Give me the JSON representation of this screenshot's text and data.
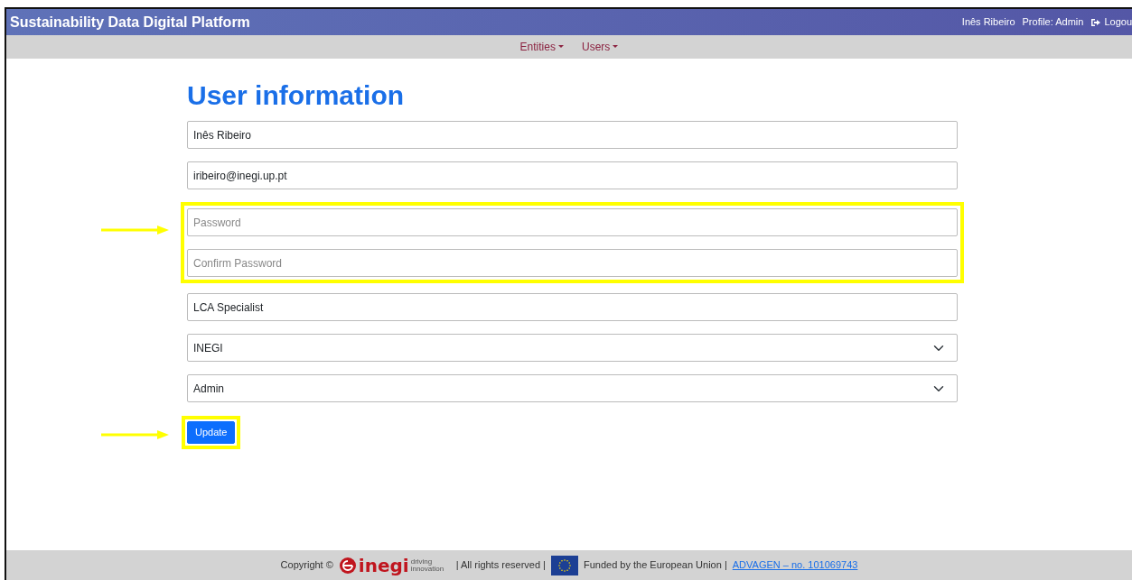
{
  "header": {
    "title": "Sustainability Data Digital Platform",
    "user": "Inês Ribeiro",
    "profile": "Profile: Admin",
    "logout": "Logou"
  },
  "menu": [
    {
      "label": "Entities"
    },
    {
      "label": "Users"
    }
  ],
  "page_title": "User information",
  "form": {
    "sections": [
      {
        "highlighted": false,
        "fields": [
          {
            "kind": "text",
            "value": "Inês Ribeiro"
          },
          {
            "kind": "text",
            "value": "iribeiro@inegi.up.pt"
          }
        ]
      },
      {
        "highlighted": true,
        "fields": [
          {
            "kind": "password",
            "placeholder": "Password"
          },
          {
            "kind": "password",
            "placeholder": "Confirm Password"
          }
        ]
      },
      {
        "highlighted": false,
        "fields": [
          {
            "kind": "text",
            "value": "LCA Specialist"
          },
          {
            "kind": "select",
            "value": "INEGI"
          },
          {
            "kind": "select",
            "value": "Admin"
          }
        ]
      }
    ],
    "submit": {
      "label": "Update",
      "highlighted": true
    }
  },
  "footer": {
    "copyright": "Copyright ©",
    "logo_name": "inegi",
    "logo_tagline": "driving innovation",
    "rights": "| All rights reserved |",
    "funded": "Funded by the European Union |",
    "link": "ADVAGEN – no. 101069743"
  }
}
